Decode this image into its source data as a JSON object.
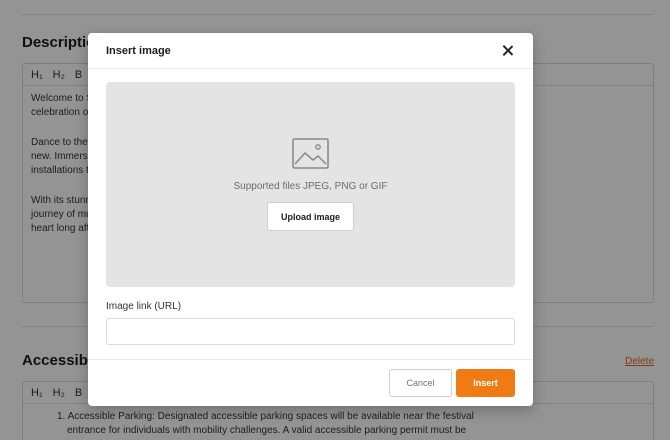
{
  "background": {
    "description_section": {
      "title": "Description",
      "toolbar": [
        "H₁",
        "H₂",
        "B"
      ],
      "paragraphs": [
        [
          "Welcome to S",
          "celebration of"
        ],
        [
          "Dance to the l",
          "new. Immerse",
          "installations th"
        ],
        [
          "With its stunn",
          "journey of mu",
          "heart long afte"
        ]
      ]
    },
    "accessibility_section": {
      "title": "Accessibili",
      "delete_label": "Delete",
      "toolbar": [
        "H₁",
        "H₂",
        "B"
      ],
      "list_item_1_lines": [
        "1. Accessible Parking: Designated accessible parking spaces will be available near the festival",
        "entrance for individuals with mobility challenges. A valid accessible parking permit must be"
      ]
    }
  },
  "modal": {
    "title": "Insert image",
    "dropzone_text": "Supported files JPEG, PNG or GIF",
    "upload_label": "Upload image",
    "url_label": "Image link (URL)",
    "url_value": "",
    "url_placeholder": "",
    "cancel_label": "Cancel",
    "insert_label": "Insert"
  },
  "icons": {
    "close": "close-icon",
    "image": "image-icon"
  },
  "colors": {
    "accent": "#f07a14",
    "link": "#e46c1a",
    "dropzone": "#e4e4e4"
  }
}
